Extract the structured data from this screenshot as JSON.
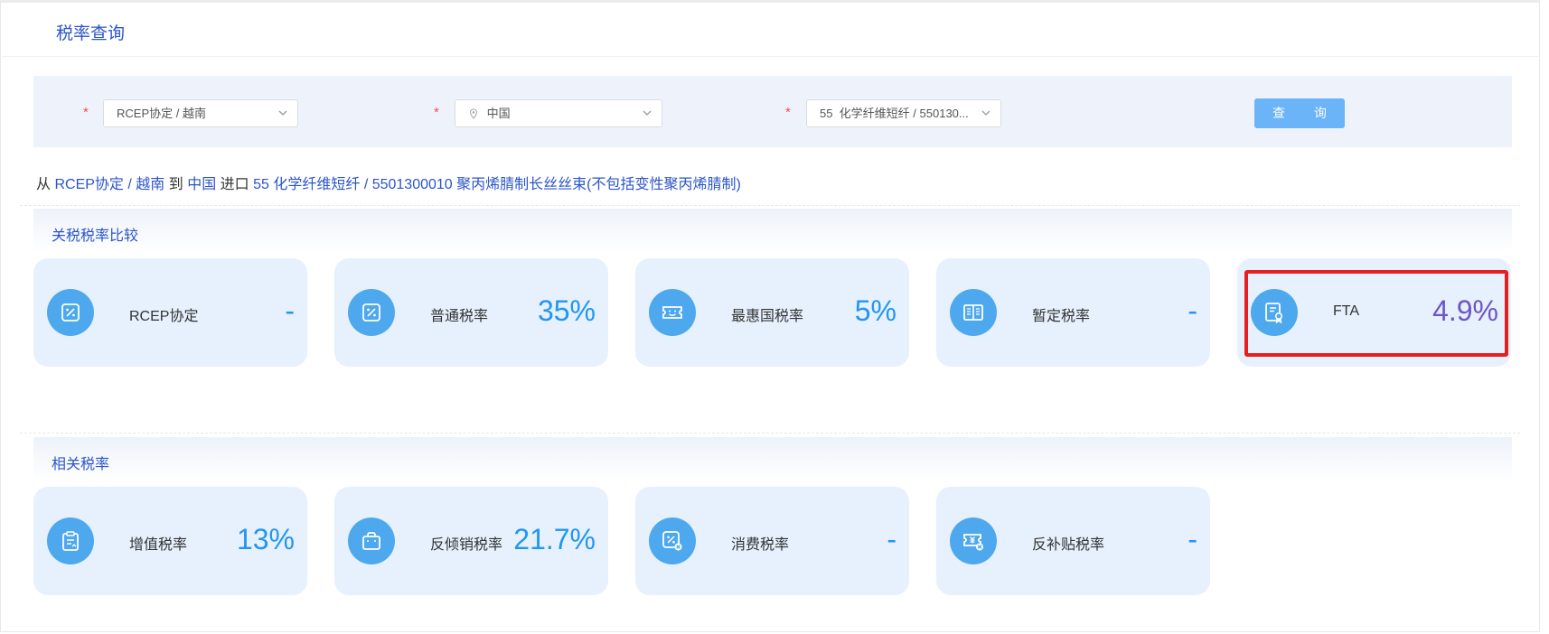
{
  "page": {
    "title": "税率查询"
  },
  "filters": {
    "required_mark": "*",
    "origin": "RCEP协定 / 越南",
    "destination": "中国",
    "commodity": "55  化学纤维短纤 / 550130...",
    "query_button": "查 询"
  },
  "route": {
    "from_word": "从",
    "origin": "RCEP协定 / 越南",
    "to_word": "到",
    "destination": "中国",
    "import_word": "进口",
    "commodity": "55 化学纤维短纤 / 5501300010 聚丙烯腈制长丝丝束(不包括变性聚丙烯腈制)"
  },
  "tariff_section": {
    "title": "关税税率比较",
    "cards": [
      {
        "label": "RCEP协定",
        "value": "-",
        "icon": "percent-tag-icon"
      },
      {
        "label": "普通税率",
        "value": "35%",
        "icon": "percent-tag-icon"
      },
      {
        "label": "最惠国税率",
        "value": "5%",
        "icon": "ticket-smile-icon"
      },
      {
        "label": "暂定税率",
        "value": "-",
        "icon": "open-book-icon"
      },
      {
        "label": "FTA",
        "value": "4.9%",
        "icon": "certificate-icon"
      }
    ]
  },
  "related_section": {
    "title": "相关税率",
    "cards": [
      {
        "label": "增值税率",
        "value": "13%",
        "icon": "clipboard-icon"
      },
      {
        "label": "反倾销税率",
        "value": "21.7%",
        "icon": "shopping-bag-icon"
      },
      {
        "label": "消费税率",
        "value": "-",
        "icon": "percent-cancel-icon"
      },
      {
        "label": "反补贴税率",
        "value": "-",
        "icon": "yuan-cancel-icon"
      }
    ]
  },
  "colors": {
    "accent": "#2196f3",
    "link_blue": "#2b55c9",
    "card_bg": "#e6f1fd",
    "icon_bg": "#4ea8ee",
    "fta_value": "#6e55c8",
    "highlight_border": "#e81f1f",
    "button_bg": "#6ab4f7"
  }
}
